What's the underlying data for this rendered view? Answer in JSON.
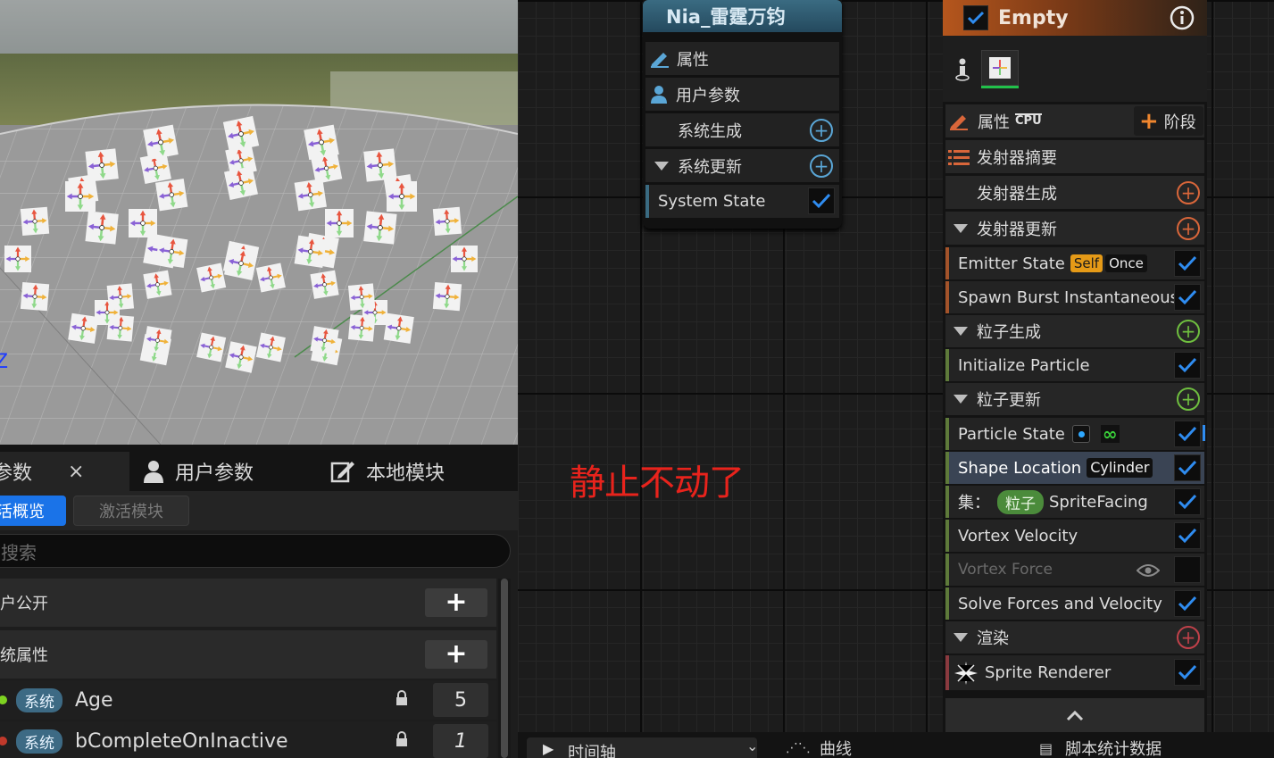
{
  "system_node": {
    "title": "Nia_雷霆万钧",
    "rows": [
      "属性",
      "用户参数",
      "系统生成",
      "系统更新",
      "System State"
    ],
    "accent": "#3a6b82"
  },
  "emitter_node": {
    "title": "Empty",
    "properties_label": "属性",
    "cpu_label": "CPU",
    "stage_button": "阶段",
    "summary_label": "发射器摘要",
    "emitter_spawn": "发射器生成",
    "emitter_update": "发射器更新",
    "emitter_state": {
      "label": "Emitter State",
      "tag_self": "Self",
      "tag_once": "Once"
    },
    "spawn_burst": "Spawn Burst Instantaneous",
    "particle_spawn": "粒子生成",
    "initialize_particle": "Initialize Particle",
    "particle_update": "粒子更新",
    "particle_state": "Particle State",
    "shape_location": {
      "label": "Shape Location",
      "tag": "Cylinder"
    },
    "set_row": {
      "label": "集：",
      "tag": "粒子",
      "value": "SpriteFacing"
    },
    "vortex_velocity": "Vortex Velocity",
    "vortex_force": "Vortex Force",
    "solve_forces": "Solve Forces and Velocity",
    "render": "渲染",
    "sprite_renderer": "Sprite Renderer",
    "accent": "#b5561d"
  },
  "annotation": "静止不动了",
  "params_panel": {
    "tab_params": "参数",
    "tab_close": "×",
    "tab_user_params": "用户参数",
    "tab_local_modules": "本地模块",
    "filter_active_overview": "活概览",
    "filter_active_modules": "激活模块",
    "search_placeholder": "搜索",
    "section_user_exposed": "户公开",
    "section_system_attributes": "统属性",
    "vars": [
      {
        "tag": "系统",
        "name": "Age",
        "value": "5",
        "dot_color": "#7ed321"
      },
      {
        "tag": "系统",
        "name": "bCompleteOnInactive",
        "value": "1",
        "dot_color": "#c0392b"
      }
    ]
  },
  "bottom_tabs": {
    "timeline": "时间轴",
    "curves": "曲线",
    "script_stats": "脚本统计数据"
  },
  "viewport": {
    "axis_label": "Z"
  }
}
